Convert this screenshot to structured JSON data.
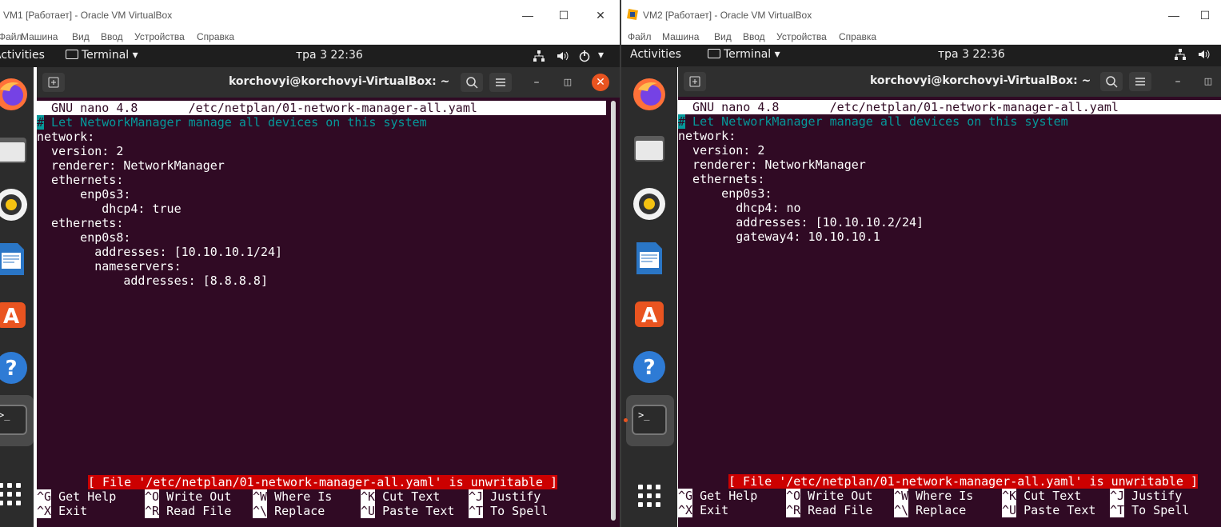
{
  "vm1": {
    "window_title": "VM1 [Работает] - Oracle VM VirtualBox",
    "menu": [
      "Файл",
      "Машина",
      "Вид",
      "Ввод",
      "Устройства",
      "Справка"
    ],
    "activities": "Activities",
    "app_menu": "Terminal",
    "clock": "тра 3  22:36",
    "terminal_title": "korchovyi@korchovyi-VirtualBox: ~",
    "nano_header": "  GNU nano 4.8       /etc/netplan/01-network-manager-all.yaml",
    "comment_line": " Let NetworkManager manage all devices on this system",
    "file_lines": [
      "network:",
      "  version: 2",
      "  renderer: NetworkManager",
      "  ethernets:",
      "      enp0s3:",
      "         dhcp4: true",
      "  ethernets:",
      "      enp0s8:",
      "        addresses: [10.10.10.1/24]",
      "        nameservers:",
      "            addresses: [8.8.8.8]"
    ],
    "status_message": "[ File '/etc/netplan/01-network-manager-all.yaml' is unwritable ]"
  },
  "vm2": {
    "window_title": "VM2 [Работает] - Oracle VM VirtualBox",
    "menu": [
      "Файл",
      "Машина",
      "Вид",
      "Ввод",
      "Устройства",
      "Справка"
    ],
    "activities": "Activities",
    "app_menu": "Terminal",
    "clock": "тра 3  22:36",
    "terminal_title": "korchovyi@korchovyi-VirtualBox: ~",
    "nano_header": "  GNU nano 4.8       /etc/netplan/01-network-manager-all.yaml",
    "comment_line": " Let NetworkManager manage all devices on this system",
    "file_lines": [
      "network:",
      "  version: 2",
      "  renderer: NetworkManager",
      "  ethernets:",
      "      enp0s3:",
      "        dhcp4: no",
      "        addresses: [10.10.10.2/24]",
      "        gateway4: 10.10.10.1"
    ],
    "status_message": "[ File '/etc/netplan/01-network-manager-all.yaml' is unwritable ]"
  },
  "shortcuts_row1": [
    {
      "key": "^G",
      "label": " Get Help"
    },
    {
      "key": "^O",
      "label": " Write Out"
    },
    {
      "key": "^W",
      "label": " Where Is"
    },
    {
      "key": "^K",
      "label": " Cut Text"
    },
    {
      "key": "^J",
      "label": " Justify"
    }
  ],
  "shortcuts_row2": [
    {
      "key": "^X",
      "label": " Exit"
    },
    {
      "key": "^R",
      "label": " Read File"
    },
    {
      "key": "^\\",
      "label": " Replace"
    },
    {
      "key": "^U",
      "label": " Paste Text"
    },
    {
      "key": "^T",
      "label": " To Spell"
    }
  ],
  "terminal_prompt_icon": ">_",
  "colors": {
    "terminal_bg": "#300a24",
    "comment": "#06989a",
    "status_bg": "#cc0000",
    "topbar": "#1e1e1e",
    "dock": "#2c2c2c",
    "close_button": "#e95420"
  }
}
